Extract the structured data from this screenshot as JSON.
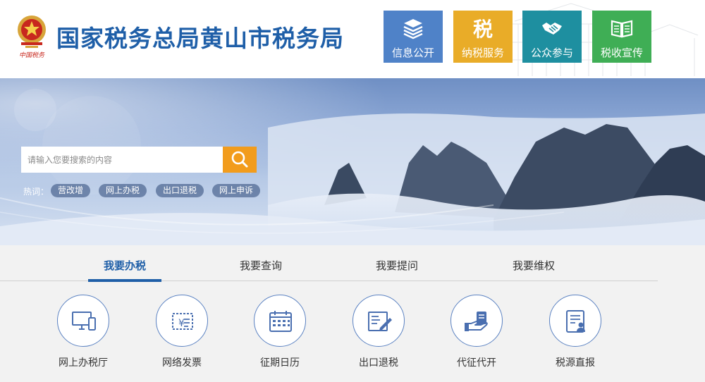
{
  "header": {
    "site_title": "国家税务总局黄山市税务局",
    "emblem_text": "中国税务",
    "nav": [
      {
        "label": "信息公开",
        "icon": "books-icon",
        "color": "#4f82c8"
      },
      {
        "label": "纳税服务",
        "icon": "tax-char-icon",
        "color": "#e9ac28"
      },
      {
        "label": "公众参与",
        "icon": "handshake-icon",
        "color": "#1e8fa0"
      },
      {
        "label": "税收宣传",
        "icon": "open-book-icon",
        "color": "#3fae55"
      }
    ],
    "nav_icon_char": "税"
  },
  "search": {
    "placeholder": "请输入您要搜索的内容",
    "hot_label": "热词：",
    "hot_tags": [
      "营改增",
      "网上办税",
      "出口退税",
      "网上申诉"
    ],
    "button_color": "#f29c1c"
  },
  "tabs": [
    {
      "label": "我要办税",
      "active": true
    },
    {
      "label": "我要查询",
      "active": false
    },
    {
      "label": "我要提问",
      "active": false
    },
    {
      "label": "我要维权",
      "active": false
    }
  ],
  "services": [
    {
      "label": "网上办税厅",
      "icon": "computer-icon"
    },
    {
      "label": "网络发票",
      "icon": "invoice-icon"
    },
    {
      "label": "征期日历",
      "icon": "calendar-icon"
    },
    {
      "label": "出口退税",
      "icon": "document-edit-icon"
    },
    {
      "label": "代征代开",
      "icon": "hand-card-icon"
    },
    {
      "label": "税源直报",
      "icon": "report-user-icon"
    }
  ],
  "colors": {
    "brand_blue": "#1f5fa8",
    "icon_blue": "#4a6fb0"
  }
}
